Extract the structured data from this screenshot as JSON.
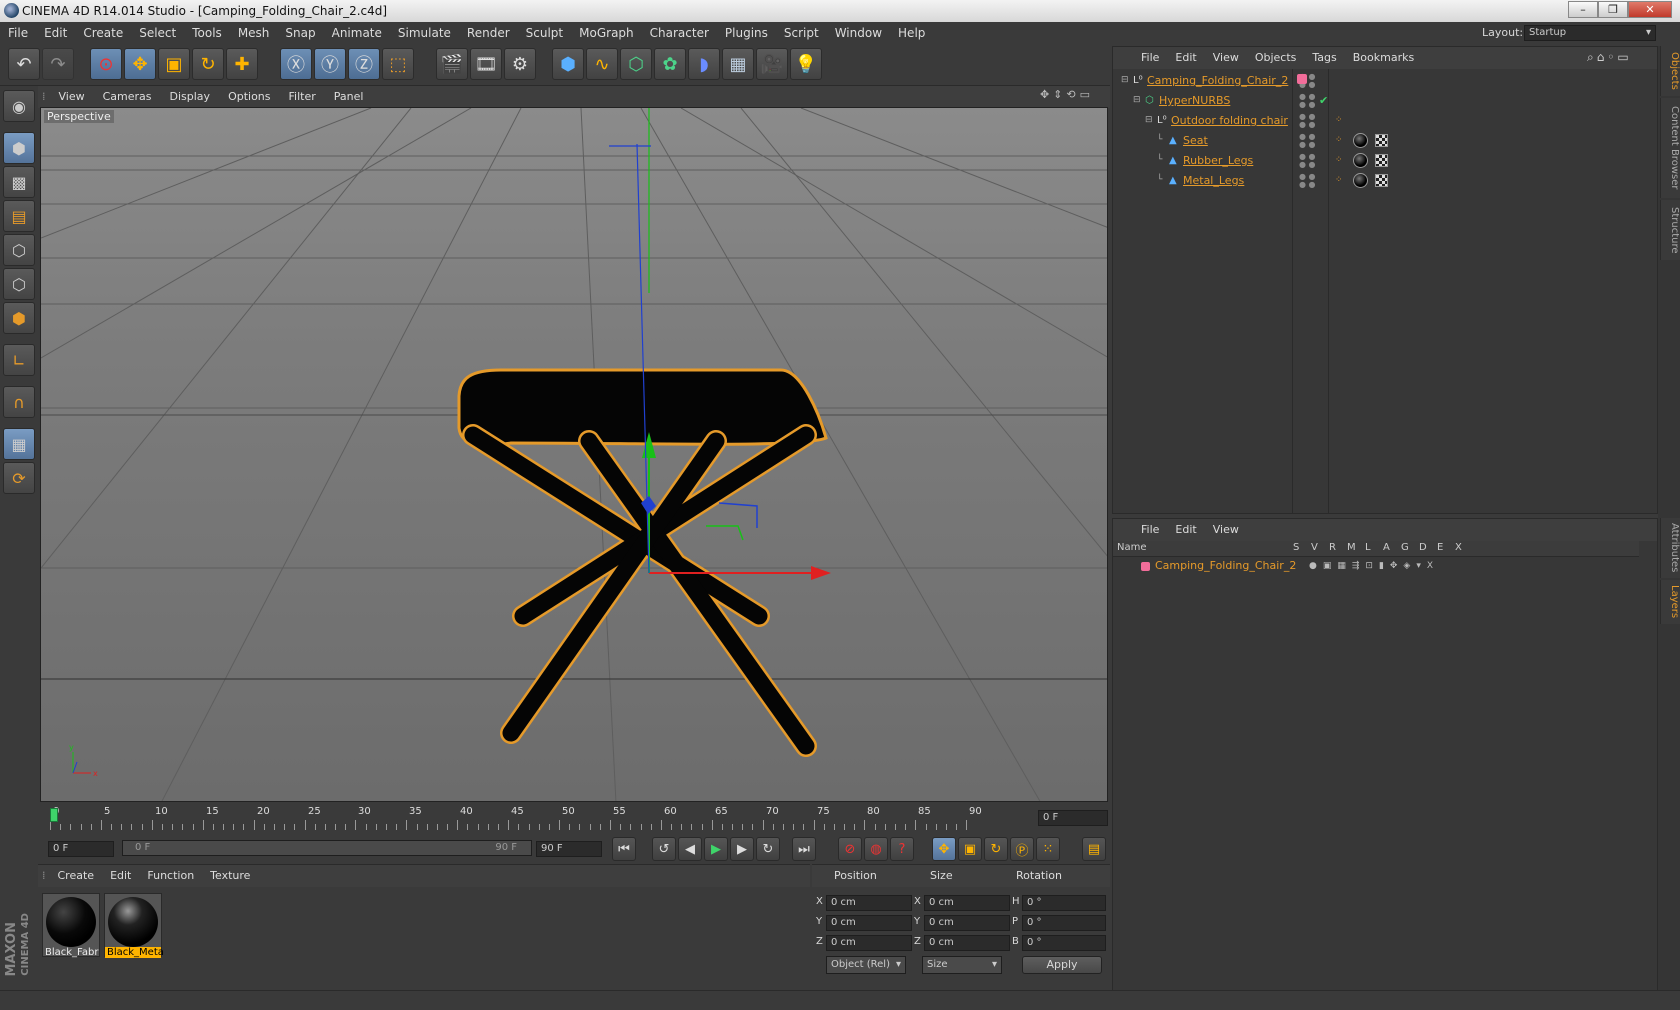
{
  "window": {
    "title": "CINEMA 4D R14.014 Studio - [Camping_Folding_Chair_2.c4d]"
  },
  "menubar": [
    "File",
    "Edit",
    "Create",
    "Select",
    "Tools",
    "Mesh",
    "Snap",
    "Animate",
    "Simulate",
    "Render",
    "Sculpt",
    "MoGraph",
    "Character",
    "Plugins",
    "Script",
    "Window",
    "Help"
  ],
  "layout": {
    "label": "Layout:",
    "value": "Startup"
  },
  "viewport": {
    "menu": [
      "View",
      "Cameras",
      "Display",
      "Options",
      "Filter",
      "Panel"
    ],
    "label": "Perspective"
  },
  "timeline": {
    "ticks": [
      "0",
      "5",
      "10",
      "15",
      "20",
      "25",
      "30",
      "35",
      "40",
      "45",
      "50",
      "55",
      "60",
      "65",
      "70",
      "75",
      "80",
      "85",
      "90"
    ],
    "current_frame": "0 F",
    "start_field": "0 F",
    "range_start": "0 F",
    "range_end": "90 F",
    "end_field": "90 F"
  },
  "materials": {
    "menu": [
      "Create",
      "Edit",
      "Function",
      "Texture"
    ],
    "items": [
      {
        "name": "Black_Fabr",
        "selected": false
      },
      {
        "name": "Black_Meta",
        "selected": true
      }
    ]
  },
  "coords": {
    "headers": [
      "Position",
      "Size",
      "Rotation"
    ],
    "rows": [
      {
        "axis": "X",
        "pos": "0 cm",
        "size_axis": "X",
        "size": "0 cm",
        "rot_axis": "H",
        "rot": "0 °"
      },
      {
        "axis": "Y",
        "pos": "0 cm",
        "size_axis": "Y",
        "size": "0 cm",
        "rot_axis": "P",
        "rot": "0 °"
      },
      {
        "axis": "Z",
        "pos": "0 cm",
        "size_axis": "Z",
        "size": "0 cm",
        "rot_axis": "B",
        "rot": "0 °"
      }
    ],
    "mode": "Object (Rel)",
    "size_mode": "Size",
    "apply": "Apply"
  },
  "objects": {
    "menu": [
      "File",
      "Edit",
      "View",
      "Objects",
      "Tags",
      "Bookmarks"
    ],
    "tree": [
      {
        "name": "Camping_Folding_Chair_2",
        "indent": 0
      },
      {
        "name": "HyperNURBS",
        "indent": 1
      },
      {
        "name": "Outdoor folding chair",
        "indent": 2
      },
      {
        "name": "Seat",
        "indent": 3
      },
      {
        "name": "Rubber_Legs",
        "indent": 3
      },
      {
        "name": "Metal_Legs",
        "indent": 3
      }
    ]
  },
  "layers": {
    "menu": [
      "File",
      "Edit",
      "View"
    ],
    "columns": [
      "Name",
      "S",
      "V",
      "R",
      "M",
      "L",
      "A",
      "G",
      "D",
      "E",
      "X"
    ],
    "rows": [
      {
        "name": "Camping_Folding_Chair_2"
      }
    ]
  },
  "right_tabs": [
    "Objects",
    "Content Browser",
    "Structure",
    "Attributes",
    "Layers"
  ],
  "brand": {
    "line1": "MAXON",
    "line2": "CINEMA 4D"
  },
  "colors": {
    "accent": "#e59a2a",
    "selected_tool": "#6d8fb5",
    "viewport": "#7c7c7c"
  }
}
